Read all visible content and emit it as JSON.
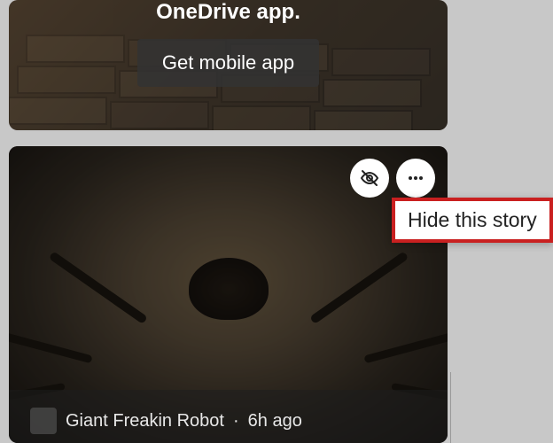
{
  "promo": {
    "title": "OneDrive app.",
    "button_label": "Get mobile app"
  },
  "story": {
    "source": "Giant Freakin Robot",
    "time": "6h ago",
    "separator": "·",
    "hide_tooltip": "Hide this story",
    "icons": {
      "hide": "hide-icon",
      "more": "more-icon"
    }
  }
}
